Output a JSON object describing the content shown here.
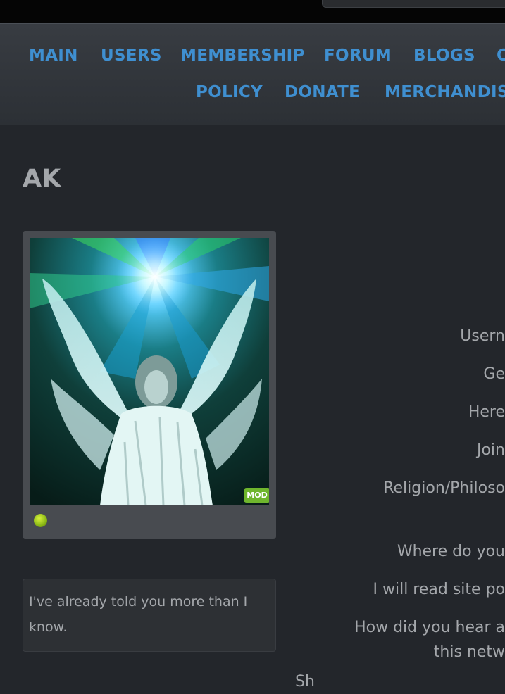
{
  "nav": {
    "row1": [
      "MAIN",
      "USERS",
      "MEMBERSHIP",
      "FORUM",
      "BLOGS",
      "C"
    ],
    "row2": [
      "POLICY",
      "DONATE",
      "MERCHANDIS"
    ]
  },
  "profile": {
    "name": "AK",
    "badge": "MOD",
    "online_status_color": "#8ab715",
    "status_message": "I've already told you more than I know."
  },
  "fields": [
    "Usern",
    "Ge",
    "Here",
    "Join",
    "Religion/Philoso",
    "Where do you",
    "I will read site po",
    "How did you hear a",
    "this netw",
    "Sh"
  ],
  "colors": {
    "link": "#3f8fd0",
    "background": "#23262b",
    "text": "#a4a7ab",
    "badge": "#6fb62d"
  }
}
